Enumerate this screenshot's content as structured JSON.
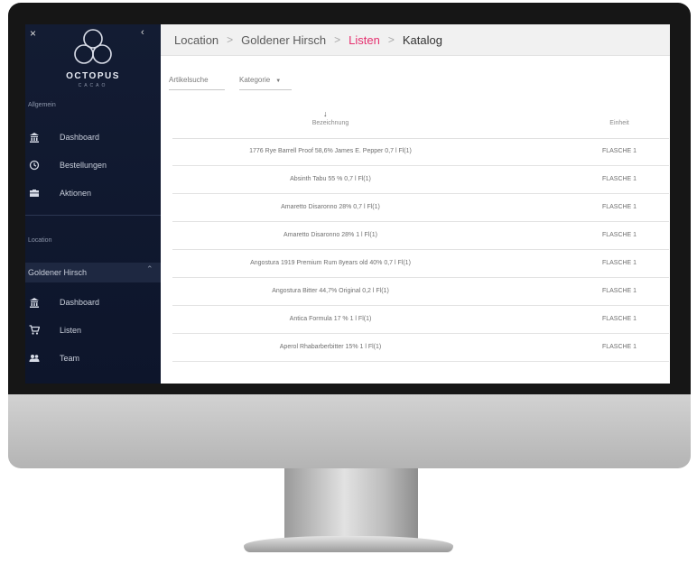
{
  "sidebar": {
    "close_glyph": "×",
    "collapse_glyph": "‹",
    "brand": "OCTOPUS",
    "brand_sub": "CACAO",
    "section_general": "Allgemein",
    "general_items": [
      {
        "label": "Dashboard",
        "icon": "bank-icon"
      },
      {
        "label": "Bestellungen",
        "icon": "history-icon"
      },
      {
        "label": "Aktionen",
        "icon": "briefcase-icon"
      }
    ],
    "section_location": "Location",
    "location_group": "Goldener Hirsch",
    "location_items": [
      {
        "label": "Dashboard",
        "icon": "bank-icon"
      },
      {
        "label": "Listen",
        "icon": "cart-icon"
      },
      {
        "label": "Team",
        "icon": "people-icon"
      }
    ]
  },
  "breadcrumb": [
    "Location",
    "Goldener Hirsch",
    "Listen",
    "Katalog"
  ],
  "breadcrumb_separator": ">",
  "filters": {
    "search_label": "Artikelsuche",
    "category_label": "Kategorie"
  },
  "table": {
    "sort_glyph": "↓",
    "col_name": "Bezeichnung",
    "col_unit": "Einheit",
    "rows": [
      {
        "name": "1776 Rye Barrell Proof 58,6% James E. Pepper 0,7 l Fl(1)",
        "unit": "FLASCHE 1"
      },
      {
        "name": "Absinth Tabu 55 % 0,7 l Fl(1)",
        "unit": "FLASCHE 1"
      },
      {
        "name": "Amaretto Disaronno 28% 0,7 l Fl(1)",
        "unit": "FLASCHE 1"
      },
      {
        "name": "Amaretto Disaronno 28% 1 l Fl(1)",
        "unit": "FLASCHE 1"
      },
      {
        "name": "Angostura 1919 Premium Rum 8years old 40% 0,7 l Fl(1)",
        "unit": "FLASCHE 1"
      },
      {
        "name": "Angostura Bitter 44,7% Original 0,2 l Fl(1)",
        "unit": "FLASCHE 1"
      },
      {
        "name": "Antica Formula 17 % 1 l Fl(1)",
        "unit": "FLASCHE 1"
      },
      {
        "name": "Aperol Rhabarberbitter 15% 1 l Fl(1)",
        "unit": "FLASCHE 1"
      }
    ]
  },
  "colors": {
    "sidebar_bg": "#131c33",
    "accent": "#e5306f",
    "topbar_bg": "#f1f1f1"
  }
}
